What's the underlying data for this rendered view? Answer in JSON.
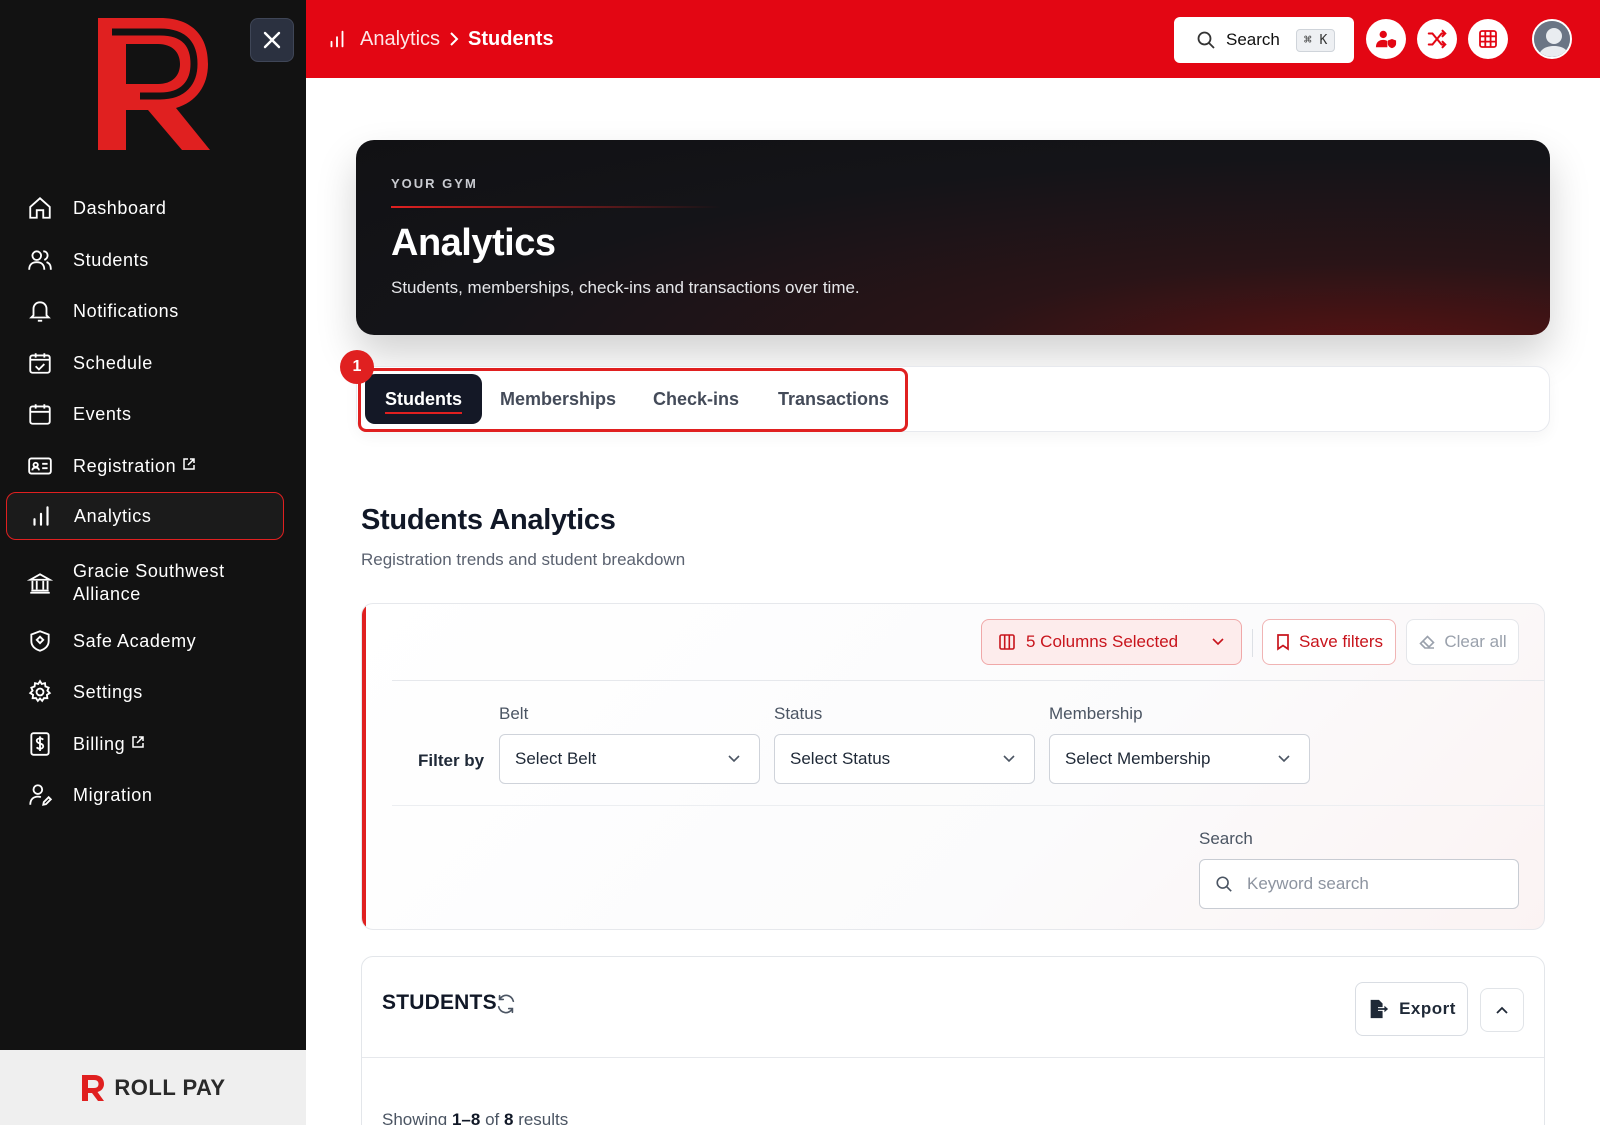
{
  "sidebar": {
    "close_icon": "close-icon",
    "items": [
      {
        "label": "Dashboard",
        "icon": "home-icon"
      },
      {
        "label": "Students",
        "icon": "users-icon"
      },
      {
        "label": "Notifications",
        "icon": "bell-icon"
      },
      {
        "label": "Schedule",
        "icon": "calendar-check-icon"
      },
      {
        "label": "Events",
        "icon": "calendar-icon"
      },
      {
        "label": "Registration",
        "icon": "id-card-icon",
        "external": true
      },
      {
        "label": "Analytics",
        "icon": "bar-chart-icon",
        "active": true
      },
      {
        "label": "Gracie Southwest Alliance",
        "icon": "bank-icon"
      },
      {
        "label": "Safe Academy",
        "icon": "shield-icon"
      },
      {
        "label": "Settings",
        "icon": "gear-icon"
      },
      {
        "label": "Billing",
        "icon": "dollar-icon",
        "external": true
      },
      {
        "label": "Migration",
        "icon": "user-edit-icon"
      }
    ],
    "footer_brand": "ROLL PAY"
  },
  "topbar": {
    "breadcrumb_parent": "Analytics",
    "breadcrumb_current": "Students",
    "search_label": "Search",
    "search_shortcut": "⌘ K",
    "action_icons": [
      "user-shield-icon",
      "shuffle-icon",
      "grid-icon"
    ]
  },
  "hero": {
    "eyebrow": "YOUR GYM",
    "title": "Analytics",
    "subtitle": "Students, memberships, check-ins and transactions over time."
  },
  "tabs": {
    "highlight_badge": "1",
    "items": [
      "Students",
      "Memberships",
      "Check-ins",
      "Transactions"
    ],
    "active": "Students"
  },
  "section": {
    "title": "Students Analytics",
    "subtitle": "Registration trends and student breakdown"
  },
  "filters": {
    "columns_label": "5 Columns Selected",
    "save_label": "Save filters",
    "clear_label": "Clear all",
    "filter_by_label": "Filter by",
    "belt": {
      "label": "Belt",
      "value": "Select Belt"
    },
    "status": {
      "label": "Status",
      "value": "Select Status"
    },
    "membership": {
      "label": "Membership",
      "value": "Select Membership"
    },
    "search": {
      "label": "Search",
      "placeholder": "Keyword search"
    }
  },
  "students_card": {
    "title": "STUDENTS",
    "export_label": "Export",
    "showing_prefix": "Showing",
    "showing_range": "1–8",
    "showing_of": "of",
    "showing_total": "8",
    "showing_suffix": "results"
  },
  "colors": {
    "brand_red": "#e30613",
    "sidebar_bg": "#121212",
    "hero_dark": "#141418"
  }
}
